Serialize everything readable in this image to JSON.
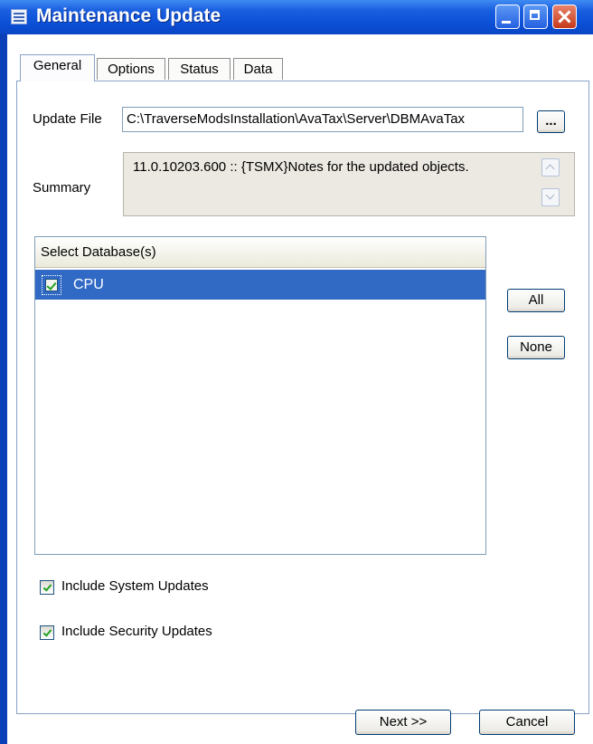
{
  "window": {
    "title": "Maintenance Update"
  },
  "tabs": [
    {
      "label": "General"
    },
    {
      "label": "Options"
    },
    {
      "label": "Status"
    },
    {
      "label": "Data"
    }
  ],
  "general": {
    "update_file_label": "Update File",
    "update_file_value": "C:\\TraverseModsInstallation\\AvaTax\\Server\\DBMAvaTax",
    "browse_label": "...",
    "summary_label": "Summary",
    "summary_text": "11.0.10203.600 :: {TSMX}Notes for the updated objects.",
    "database_list": {
      "header": "Select Database(s)",
      "items": [
        {
          "label": "CPU",
          "checked": true,
          "selected": true
        }
      ]
    },
    "all_label": "All",
    "none_label": "None",
    "include_system": {
      "label": "Include System Updates",
      "checked": true
    },
    "include_security": {
      "label": "Include Security Updates",
      "checked": true
    }
  },
  "footer": {
    "next_label": "Next >>",
    "cancel_label": "Cancel"
  },
  "colors": {
    "titlebar": "#0a4fd6",
    "selection": "#316ac5",
    "check": "#21a121"
  }
}
